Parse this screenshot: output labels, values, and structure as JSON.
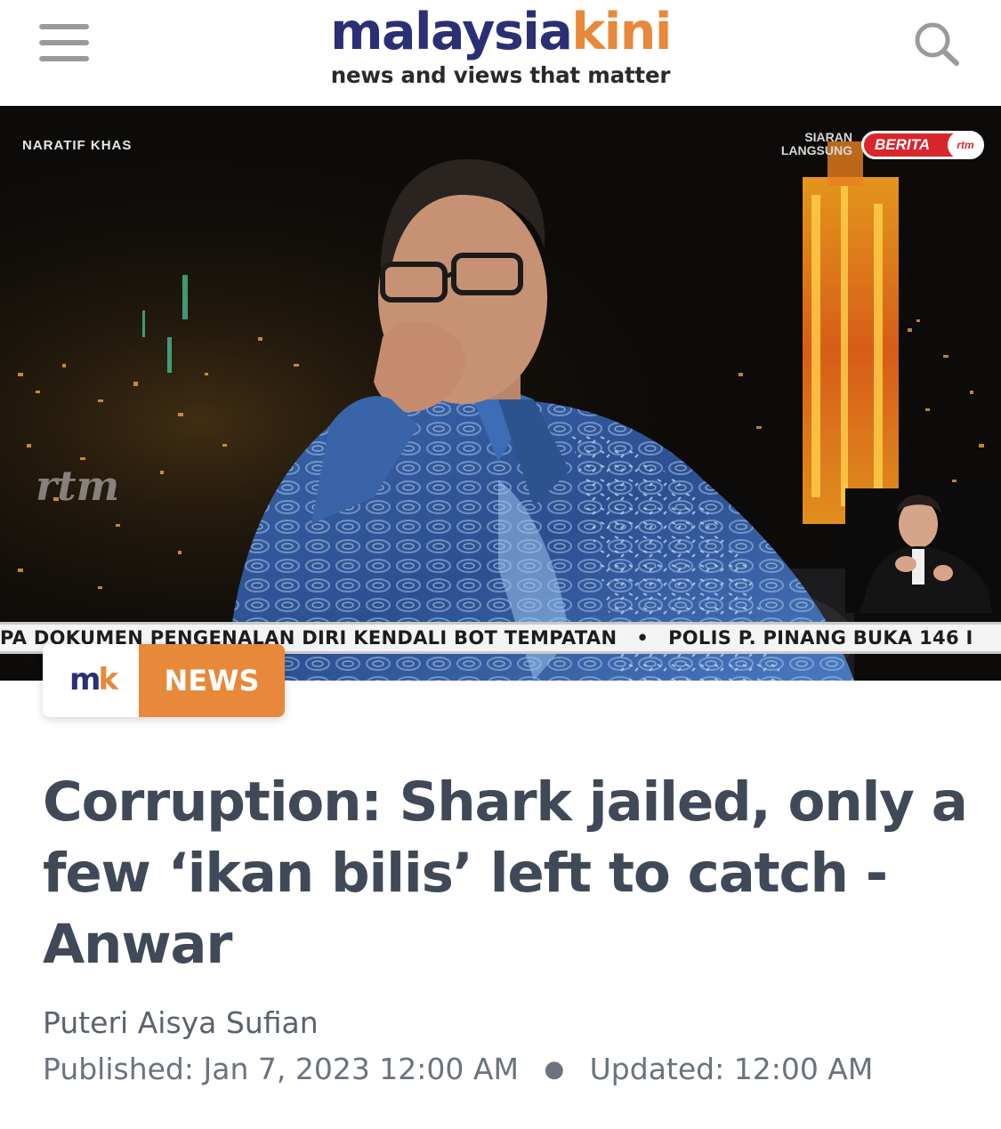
{
  "header": {
    "logo_part1": "malaysia",
    "logo_part2": "kini",
    "tagline": "news and views that matter",
    "menu_icon": "hamburger-menu-icon",
    "search_icon": "search-icon",
    "brand_dark": "#2b2f74",
    "brand_orange": "#e8883a"
  },
  "hero": {
    "program_label": "NARATIF KHAS",
    "live_label": "SIARAN LANGSUNG",
    "channel_badge": "BERITA",
    "channel_logo": "rtm",
    "watermark": "rtm",
    "ticker_left": "PA DOKUMEN PENGENALAN DIRI KENDALI BOT TEMPATAN",
    "ticker_right": "POLIS P. PINANG BUKA 146 I"
  },
  "badge": {
    "logo_m": "m",
    "logo_k": "k",
    "section": "NEWS"
  },
  "article": {
    "headline": "Corruption: Shark jailed, only a few ‘ikan bilis’ left to catch - Anwar",
    "author": "Puteri Aisya Sufian",
    "published_label": "Published:",
    "published_value": "Jan 7, 2023 12:00 AM",
    "updated_label": "Updated:",
    "updated_value": "12:00 AM"
  }
}
